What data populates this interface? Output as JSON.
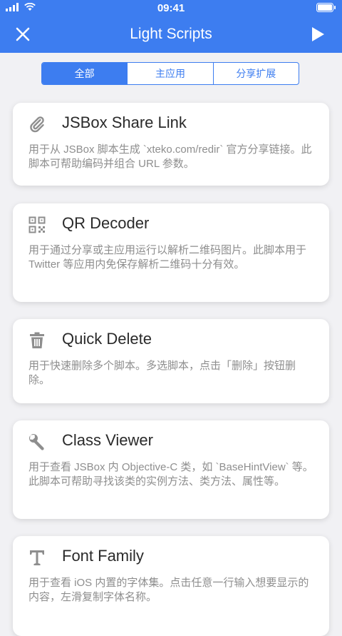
{
  "status_bar": {
    "time": "09:41"
  },
  "nav": {
    "title": "Light Scripts"
  },
  "segments": [
    {
      "label": "全部",
      "selected": true
    },
    {
      "label": "主应用",
      "selected": false
    },
    {
      "label": "分享扩展",
      "selected": false
    }
  ],
  "cards": [
    {
      "icon": "paperclip-icon",
      "title": "JSBox Share Link",
      "desc": "用于从 JSBox 脚本生成 `xteko.com/redir` 官方分享链接。此脚本可帮助编码并组合 URL 参数。"
    },
    {
      "icon": "qrcode-icon",
      "title": "QR Decoder",
      "desc": "用于通过分享或主应用运行以解析二维码图片。此脚本用于 Twitter 等应用内免保存解析二维码十分有效。"
    },
    {
      "icon": "trash-icon",
      "title": "Quick Delete",
      "desc": "用于快速删除多个脚本。多选脚本，点击「删除」按钮删除。"
    },
    {
      "icon": "wrench-icon",
      "title": "Class Viewer",
      "desc": "用于查看 JSBox 内 Objective-C 类，如 `BaseHintView` 等。此脚本可帮助寻找该类的实例方法、类方法、属性等。"
    },
    {
      "icon": "font-icon",
      "title": "Font Family",
      "desc": "用于查看 iOS 内置的字体集。点击任意一行输入想要显示的内容，左滑复制字体名称。"
    }
  ],
  "colors": {
    "accent": "#3d7df0",
    "background": "#f1f1f4",
    "icon": "#8e8e8e"
  }
}
